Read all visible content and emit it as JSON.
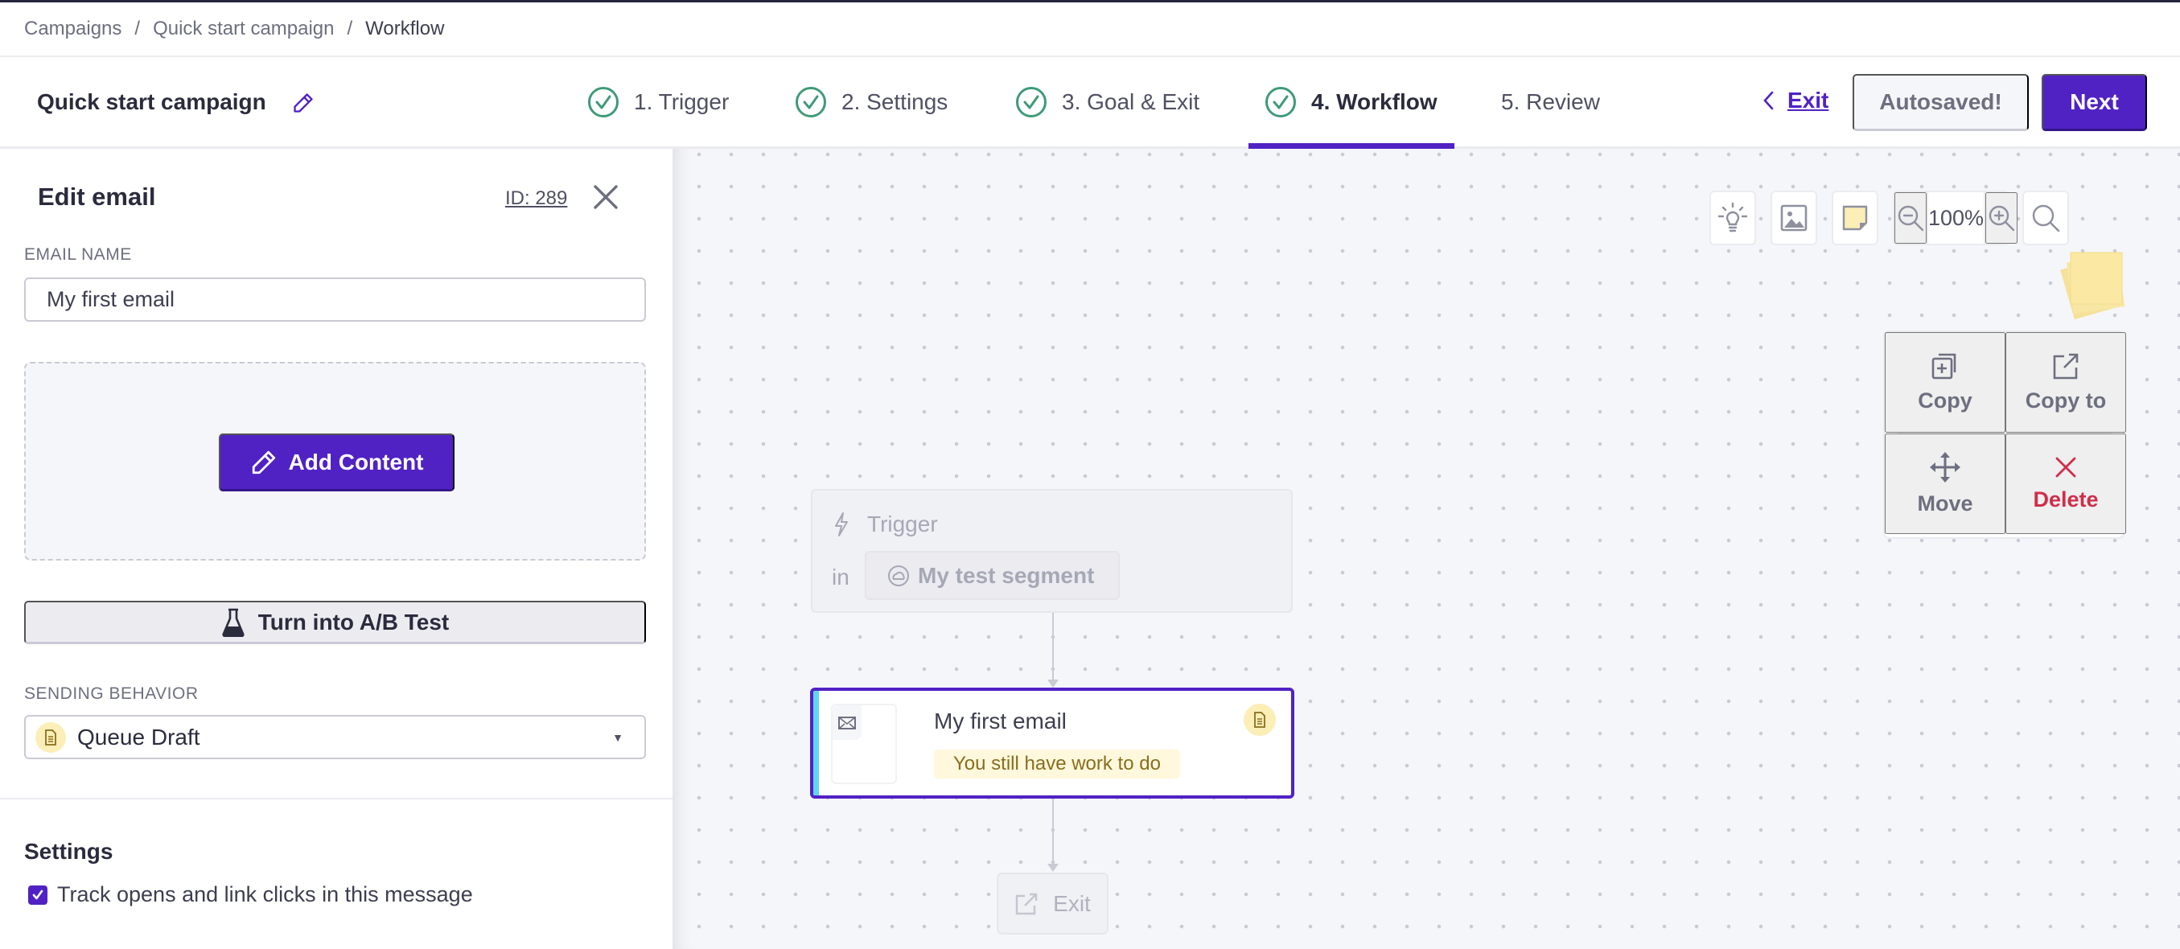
{
  "breadcrumb": [
    "Campaigns",
    "Quick start campaign",
    "Workflow"
  ],
  "header": {
    "campaign_title": "Quick start campaign",
    "steps": [
      {
        "label": "1. Trigger",
        "completed": true,
        "active": false
      },
      {
        "label": "2. Settings",
        "completed": true,
        "active": false
      },
      {
        "label": "3. Goal & Exit",
        "completed": true,
        "active": false
      },
      {
        "label": "4. Workflow",
        "completed": true,
        "active": true
      },
      {
        "label": "5. Review",
        "completed": false,
        "active": false
      }
    ],
    "exit_label": "Exit",
    "autosaved_label": "Autosaved!",
    "next_label": "Next"
  },
  "sidebar": {
    "title": "Edit email",
    "id_label": "ID: 289",
    "email_name_label": "EMAIL NAME",
    "email_name_value": "My first email",
    "add_content_label": "Add Content",
    "ab_test_label": "Turn into A/B Test",
    "sending_behavior_label": "SENDING BEHAVIOR",
    "sending_behavior_value": "Queue Draft",
    "settings_heading": "Settings",
    "track_checkbox_label": "Track opens and link clicks in this message",
    "track_checked": true
  },
  "canvas": {
    "zoom_value": "100%",
    "actions": {
      "copy": "Copy",
      "copy_to": "Copy to",
      "move": "Move",
      "delete": "Delete"
    },
    "trigger_node": {
      "title": "Trigger",
      "in_label": "in",
      "segment": "My test segment"
    },
    "email_node": {
      "title": "My first email",
      "status": "You still have work to do"
    },
    "exit_node": {
      "label": "Exit"
    }
  },
  "colors": {
    "accent": "#5022c4",
    "success": "#3f9a78",
    "danger": "#cf2e4a",
    "draft_badge_bg": "#fbeeb6",
    "email_stripe": "#5fd6ef"
  }
}
